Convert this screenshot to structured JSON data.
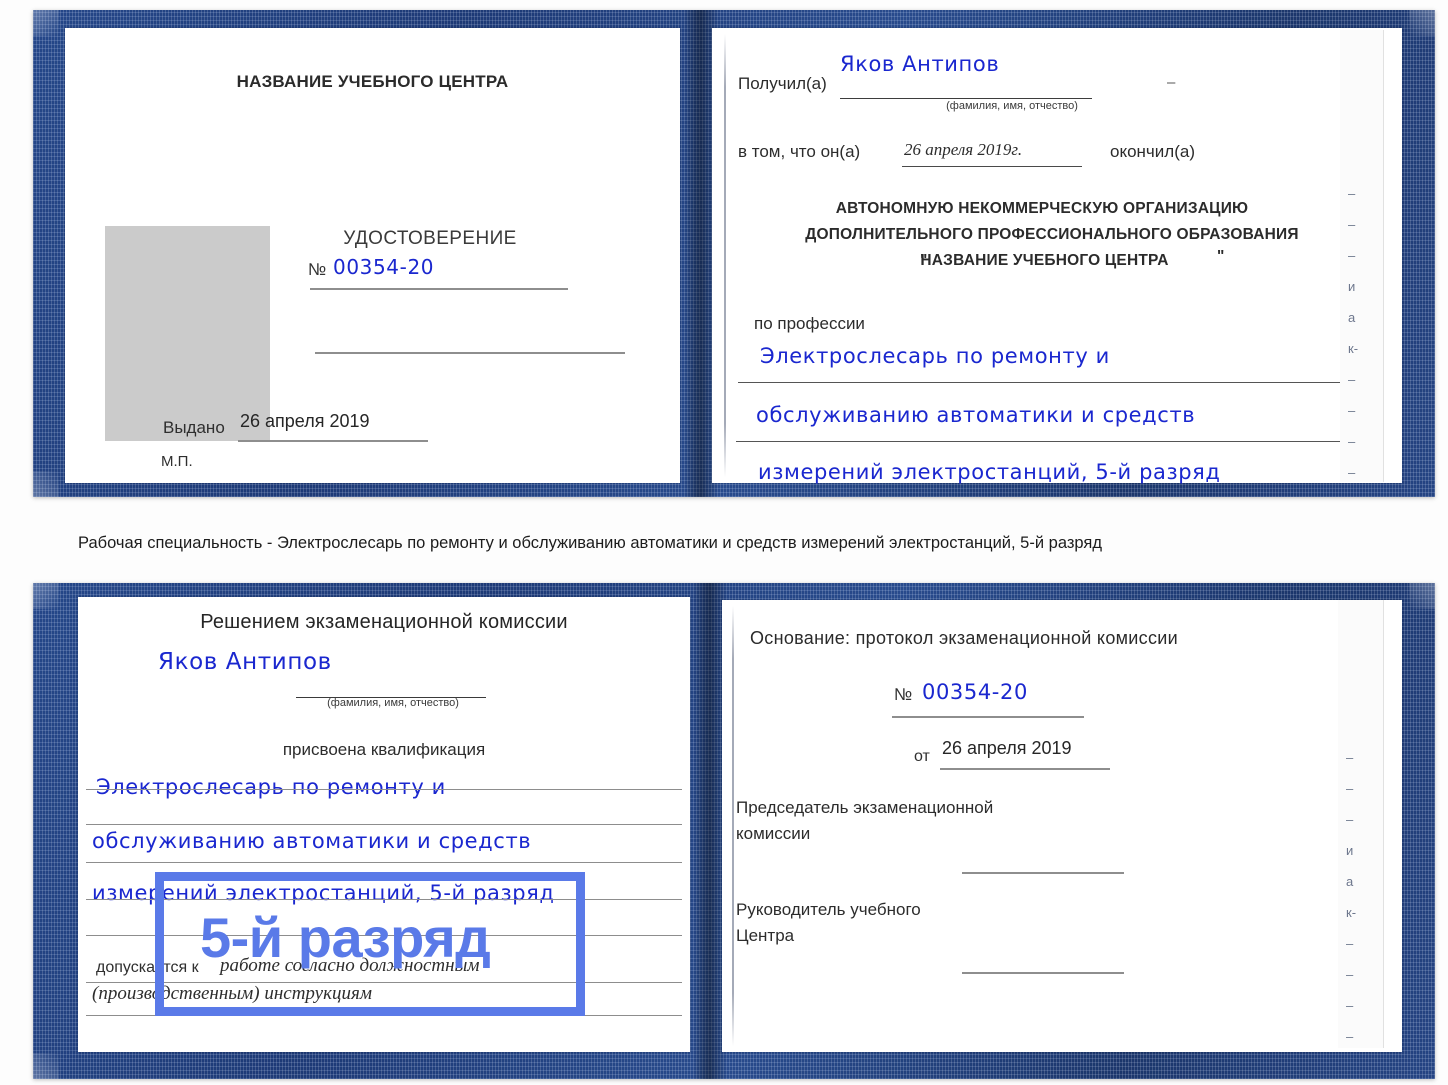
{
  "caption": {
    "text": "Рабочая специальность - Электрослесарь по ремонту и обслуживанию автоматики и средств измерений электростанций, 5-й разряд"
  },
  "highlight": {
    "label": "5-й разряд",
    "color": "#5a7ae8"
  },
  "colors": {
    "cover_blue": "#274b91",
    "handwriting_blue": "#1a27cf",
    "photo_placeholder": "#cbcbcb",
    "rule_gray": "#9a9a9a",
    "highlight_blue": "#5a7ae8"
  },
  "certificate_top": {
    "left_page": {
      "header": "НАЗВАНИЕ УЧЕБНОГО ЦЕНТРА",
      "photo_placeholder_label": "photo",
      "title": "УДОСТОВЕРЕНИЕ",
      "number_symbol": "№",
      "number_value": "00354-20",
      "issued_label": "Выдано",
      "issued_value": "26 апреля 2019",
      "seal_label": "М.П."
    },
    "right_page": {
      "received_label": "Получил(а)",
      "received_value": "Яков Антипов",
      "fio_hint": "(фамилия, имя, отчество)",
      "that_he_label": "в том, что он(а)",
      "completion_date": "26 апреля 2019г.",
      "finished_label": "окончил(а)",
      "org_line_1": "АВТОНОМНУЮ НЕКОММЕРЧЕСКУЮ ОРГАНИЗАЦИЮ",
      "org_line_2": "ДОПОЛНИТЕЛЬНОГО ПРОФЕССИОНАЛЬНОГО ОБРАЗОВАНИЯ",
      "org_quote_open": "\"",
      "org_name": "НАЗВАНИЕ УЧЕБНОГО ЦЕНТРА",
      "org_quote_close": "\"",
      "profession_label": "по профессии",
      "profession_line_1": "Электрослесарь по ремонту и",
      "profession_line_2": "обслуживанию автоматики и средств",
      "profession_line_3": "измерений электростанций, 5-й разряд"
    },
    "right_edge_bleed": [
      "–",
      "–",
      "–",
      "и",
      "а",
      "к-",
      "–",
      "–",
      "–",
      "–"
    ]
  },
  "certificate_bottom": {
    "left_page": {
      "header": "Решением экзаменационной комиссии",
      "name_value": "Яков Антипов",
      "fio_hint": "(фамилия, имя, отчество)",
      "qualification_label": "присвоена квалификация",
      "qualification_line_1": "Электрослесарь по ремонту и",
      "qualification_line_2": "обслуживанию автоматики и средств",
      "qualification_line_3": "измерений электростанций, 5-й разряд",
      "admitted_label": "допускается к",
      "admitted_value_1": "работе согласно должностным",
      "admitted_value_2": "(производственным) инструкциям"
    },
    "right_page": {
      "basis_label": "Основание: протокол экзаменационной комиссии",
      "number_symbol": "№",
      "number_value": "00354-20",
      "date_label": "от",
      "date_value": "26 апреля 2019",
      "chairman_line_1": "Председатель экзаменационной",
      "chairman_line_2": "комиссии",
      "head_line_1": "Руководитель учебного",
      "head_line_2": "Центра"
    },
    "right_edge_bleed": [
      "–",
      "–",
      "–",
      "и",
      "а",
      "к-",
      "–",
      "–",
      "–",
      "–"
    ]
  }
}
